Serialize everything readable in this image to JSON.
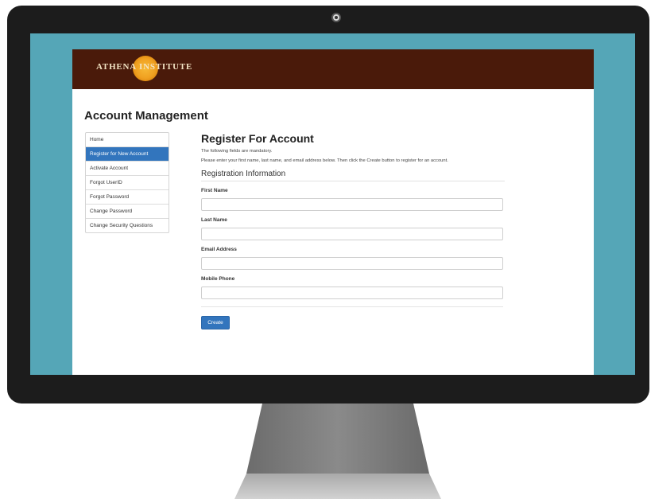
{
  "header": {
    "logo_left": "ATHENA",
    "logo_right": "INSTITUTE"
  },
  "page_heading": "Account Management",
  "sidebar": {
    "items": [
      {
        "label": "Home",
        "active": false
      },
      {
        "label": "Register for New Account",
        "active": true
      },
      {
        "label": "Activate Account",
        "active": false
      },
      {
        "label": "Forgot UserID",
        "active": false
      },
      {
        "label": "Forgot Password",
        "active": false
      },
      {
        "label": "Change Password",
        "active": false
      },
      {
        "label": "Change Security Questions",
        "active": false
      }
    ]
  },
  "main": {
    "title": "Register For Account",
    "mandatory_note": "The following fields are mandatory.",
    "instructions": "Please enter your first name, last name, and email address below. Then click the Create button to register for an account.",
    "section_title": "Registration Information",
    "fields": [
      {
        "label": "First Name",
        "value": ""
      },
      {
        "label": "Last Name",
        "value": ""
      },
      {
        "label": "Email Address",
        "value": ""
      },
      {
        "label": "Mobile Phone",
        "value": ""
      }
    ],
    "create_label": "Create"
  },
  "colors": {
    "header_bg": "#4a1a0a",
    "accent": "#3275bd",
    "screen_bg": "#55a6b7",
    "bezel": "#1c1c1c"
  }
}
